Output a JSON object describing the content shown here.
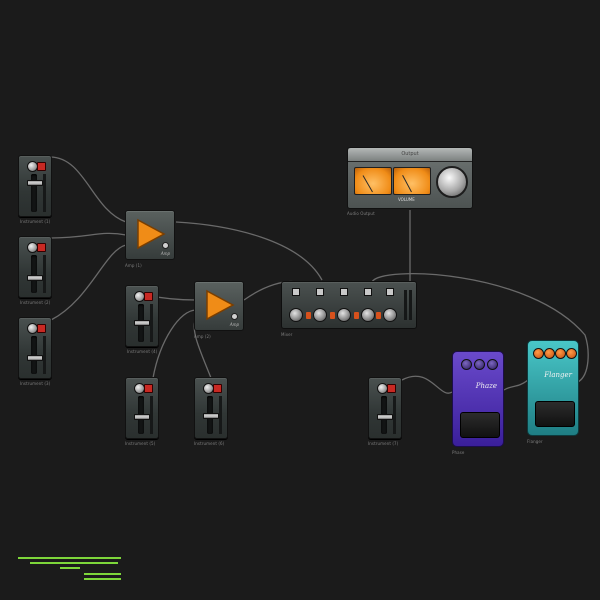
{
  "modules": {
    "fader_1": {
      "caption": "Instrument (1)",
      "fader_level": 0.7
    },
    "fader_2": {
      "caption": "Instrument (2)",
      "fader_level": 0.55
    },
    "fader_3": {
      "caption": "Instrument (3)",
      "fader_level": 0.45
    },
    "fader_4": {
      "caption": "Instrument (4)",
      "fader_level": 0.5
    },
    "fader_5": {
      "caption": "Instrument (5)",
      "fader_level": 0.45
    },
    "fader_6": {
      "caption": "Instrument (6)",
      "fader_level": 0.5
    },
    "fader_7": {
      "caption": "Instrument (7)",
      "fader_level": 0.45
    },
    "amp_1": {
      "caption": "Amp (1)",
      "signature": "Amp"
    },
    "amp_2": {
      "caption": "Amp (2)",
      "signature": "Amp"
    },
    "mixer": {
      "caption": "Mixer"
    },
    "output": {
      "title": "Output",
      "caption": "Audio Output",
      "meter_label": "VOLUME"
    },
    "pedal_purple": {
      "caption": "Phase",
      "logo": "Phaze"
    },
    "pedal_teal": {
      "caption": "Flanger",
      "logo": "Flanger"
    }
  },
  "colors": {
    "background": "#1b1b1b",
    "cable": "#6a6a6a",
    "mute_red": "#c82923",
    "amp_orange": "#f08c17",
    "vu_orange": "#f59b2a",
    "purple_pedal": "#5b3dbf",
    "teal_pedal": "#3bb6b8",
    "legend_green": "#7dd63a"
  },
  "icons": {
    "amp": "orange-triangle-icon",
    "mute": "mute-button-icon",
    "knob": "rotary-knob-icon"
  }
}
